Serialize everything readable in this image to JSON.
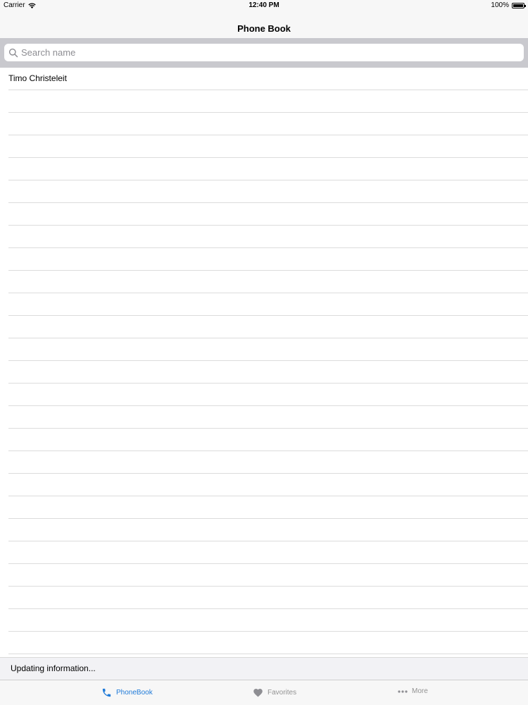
{
  "status_bar": {
    "carrier": "Carrier",
    "time": "12:40 PM",
    "battery": "100%",
    "battery_level": 1.0
  },
  "nav": {
    "title": "Phone Book"
  },
  "search": {
    "placeholder": "Search name",
    "value": ""
  },
  "list": {
    "items": [
      "Timo Christeleit"
    ]
  },
  "status_message": "Updating information...",
  "tabs": [
    {
      "label": "PhoneBook",
      "icon": "phone-icon",
      "active": true
    },
    {
      "label": "Favorites",
      "icon": "heart-icon",
      "active": false
    },
    {
      "label": "More",
      "icon": "more-dots-icon",
      "active": false
    }
  ],
  "colors": {
    "accent": "#1f7ad8",
    "inactive": "#929292",
    "search_bar_bg": "#c9c9ce"
  }
}
